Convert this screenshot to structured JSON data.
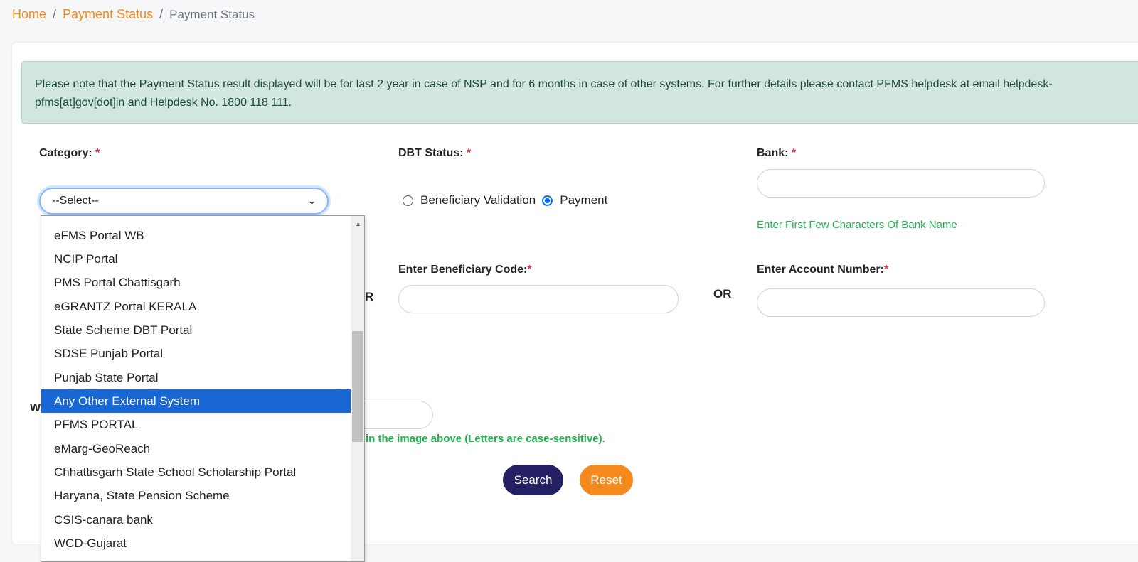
{
  "breadcrumb": {
    "home": "Home",
    "sep": "/",
    "parent": "Payment Status",
    "current": "Payment Status"
  },
  "notice": {
    "text": "Please note that the Payment Status result displayed will be for last 2 year in case of NSP and for 6 months in case of other systems. For further details please contact PFMS helpdesk at email helpdesk-pfms[at]gov[dot]in and Helpdesk No. 1800 118 111."
  },
  "form": {
    "category_label": "Category:",
    "category_value": "--Select--",
    "dbt_label": "DBT Status:",
    "radio_beneficiary": "Beneficiary Validation",
    "radio_payment": "Payment",
    "bank_label": "Bank:",
    "bank_hint": "Enter First Few Characters Of Bank Name",
    "beneficiary_code_label": "Enter Beneficiary Code:",
    "account_number_label": "Enter Account Number:",
    "or_text": "OR",
    "required_mark": "*",
    "captcha_hint_partial": "in the image above (Letters are case-sensitive).",
    "partial_label_w": "W",
    "partial_or_r": "R",
    "search_label": "Search",
    "reset_label": "Reset"
  },
  "dropdown": {
    "options": [
      "eFMS Portal WB",
      "NCIP Portal",
      "PMS Portal Chattisgarh",
      "eGRANTZ Portal KERALA",
      "State Scheme DBT Portal",
      "SDSE Punjab Portal",
      "Punjab State Portal",
      "Any Other External System",
      "PFMS PORTAL",
      "eMarg-GeoReach",
      "Chhattisgarh State School Scholarship Portal",
      "Haryana, State Pension Scheme",
      "CSIS-canara bank",
      "WCD-Gujarat"
    ],
    "selected_index": 7
  },
  "colors": {
    "accent_orange": "#f48a1e",
    "search_button": "#252063",
    "hint_green": "#22b14c",
    "selected_option": "#1967d2"
  }
}
